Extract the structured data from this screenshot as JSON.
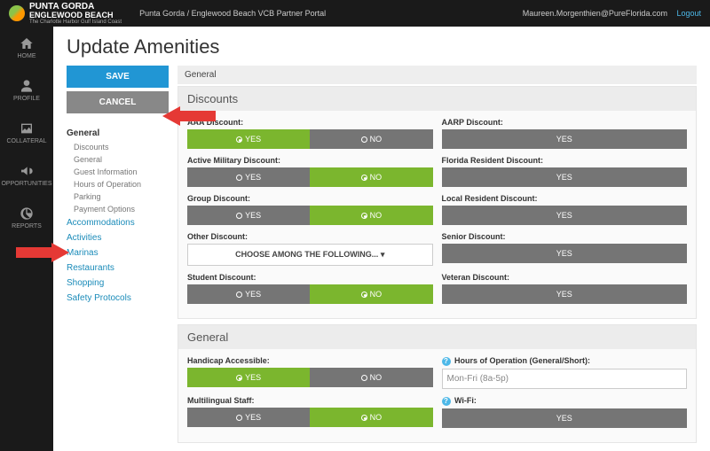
{
  "header": {
    "brand_l1": "PUNTA GORDA",
    "brand_l2": "ENGLEWOOD BEACH",
    "brand_l3": "The Charlotte Harbor Gulf Island Coast",
    "portal_title": "Punta Gorda / Englewood Beach VCB Partner Portal",
    "user": "Maureen.Morgenthien@PureFlorida.com",
    "logout": "Logout"
  },
  "rail": [
    {
      "label": "HOME",
      "icon": "home"
    },
    {
      "label": "PROFILE",
      "icon": "user"
    },
    {
      "label": "COLLATERAL",
      "icon": "image"
    },
    {
      "label": "OPPORTUNITIES",
      "icon": "megaphone"
    },
    {
      "label": "REPORTS",
      "icon": "chart"
    }
  ],
  "page_title": "Update Amenities",
  "actions": {
    "save": "SAVE",
    "cancel": "CANCEL"
  },
  "nav": {
    "active_group": "General",
    "sub_items": [
      "Discounts",
      "General",
      "Guest Information",
      "Hours of Operation",
      "Parking",
      "Payment Options"
    ],
    "links": [
      "Accommodations",
      "Activities",
      "Marinas",
      "Restaurants",
      "Shopping",
      "Safety Protocols"
    ]
  },
  "breadcrumb": "General",
  "labels": {
    "yes": "YES",
    "no": "NO",
    "choose": "CHOOSE AMONG THE FOLLOWING..."
  },
  "sections": [
    {
      "title": "Discounts",
      "rows": [
        {
          "left": {
            "label": "AAA Discount:",
            "type": "yn",
            "selected": "yes"
          },
          "right": {
            "label": "AARP Discount:",
            "type": "y"
          }
        },
        {
          "left": {
            "label": "Active Military Discount:",
            "type": "yn",
            "selected": "no"
          },
          "right": {
            "label": "Florida Resident Discount:",
            "type": "y"
          }
        },
        {
          "left": {
            "label": "Group Discount:",
            "type": "yn",
            "selected": "no"
          },
          "right": {
            "label": "Local Resident Discount:",
            "type": "y"
          }
        },
        {
          "left": {
            "label": "Other Discount:",
            "type": "choose"
          },
          "right": {
            "label": "Senior Discount:",
            "type": "y"
          }
        },
        {
          "left": {
            "label": "Student Discount:",
            "type": "yn",
            "selected": "no"
          },
          "right": {
            "label": "Veteran Discount:",
            "type": "y"
          }
        }
      ]
    },
    {
      "title": "General",
      "rows": [
        {
          "left": {
            "label": "Handicap Accessible:",
            "type": "yn",
            "selected": "yes"
          },
          "right": {
            "label": "Hours of Operation (General/Short):",
            "type": "text",
            "value": "Mon-Fri (8a-5p)",
            "help": true
          }
        },
        {
          "left": {
            "label": "Multilingual Staff:",
            "type": "yn",
            "selected": "no"
          },
          "right": {
            "label": "Wi-Fi:",
            "type": "y",
            "help": true
          }
        }
      ]
    }
  ]
}
